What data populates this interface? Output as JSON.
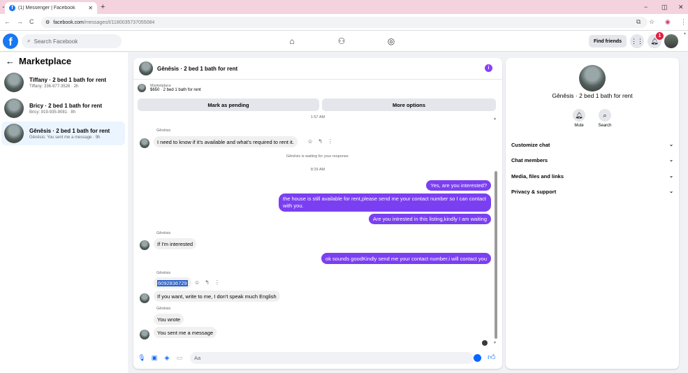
{
  "browser": {
    "tab_title": "(1) Messenger | Facebook",
    "fb_glyph": "f",
    "url_prefix": "facebook.com",
    "url_path": "/messages/t/1180035737055084",
    "controls": {
      "back": "←",
      "forward": "→",
      "reload": "C",
      "minimize": "−",
      "restore": "◫",
      "close": "✕",
      "new_tab": "+"
    }
  },
  "header": {
    "search_placeholder": "Search Facebook",
    "find_friends": "Find friends",
    "notification_count": "1"
  },
  "left_panel": {
    "title": "Marketplace",
    "back_arrow": "←",
    "conversations": [
      {
        "name": "Tiffany · 2 bed 1 bath for rent",
        "sub": "Tiffany: 336-977-3526 · 2h"
      },
      {
        "name": "Bricy · 2 bed 1 bath for rent",
        "sub": "Bricy: 919-935-9081 · 8h"
      },
      {
        "name": "Gênêsis · 2 bed 1 bath for rent",
        "sub": "Gênêsis: You sent me a message · 9h"
      }
    ]
  },
  "chat": {
    "title": "Gênêsis · 2 bed 1 bath for rent",
    "marketplace_label": "Marketplace",
    "listing": "$650 · 2 bed 1 bath for rent",
    "mark_pending": "Mark as pending",
    "more_options": "More options",
    "time1": "1:57 AM",
    "sender": "Gênêsis",
    "msg1": "I need to know if it's available and what's required to rent it.",
    "waiting": "Gênêsis is waiting for your response.",
    "time2": "8:29 AM",
    "out1": "Yes, are you interested?",
    "out2": "the house is still available for rent,please send me your contact number so I can contact with you.",
    "out3": "Are you intrested in this listing,kindly I am waiting",
    "msg2": "If I'm interested",
    "out4": "ok sounds goodKindly send me your contact number.i will contact you",
    "msg3": "6092836729",
    "msg4": "If you want, write to me, I don't speak much English",
    "msg5": "You wrote",
    "msg6": "You sent me a message",
    "composer_placeholder": "Aa"
  },
  "right_panel": {
    "name": "Gênêsis · 2 bed 1 bath for rent",
    "mute": "Mute",
    "search": "Search",
    "sections": [
      "Customize chat",
      "Chat members",
      "Media, files and links",
      "Privacy & support"
    ]
  },
  "colors": {
    "brand": "#1877f2",
    "outgoing_bubble": "#7b3ff2",
    "accent": "#0866ff"
  }
}
